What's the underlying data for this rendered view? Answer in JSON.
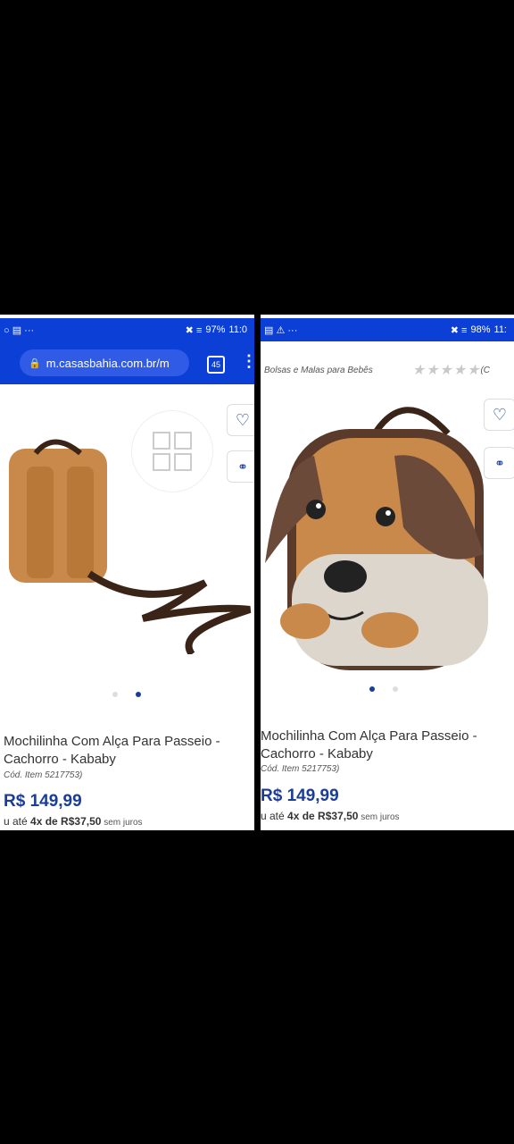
{
  "left": {
    "status": {
      "left_icons": "○ ▤ ···",
      "right_icons": "✖ ≡",
      "battery": "97%",
      "time": "11:0"
    },
    "url": "m.casasbahia.com.br/m",
    "tabs_count": "45",
    "product": {
      "title_line1": "Mochilinha Com Alça Para Passeio -",
      "title_line2": "Cachorro - Kababy",
      "code": "Cód. Item 5217753)",
      "price": "R$ 149,99",
      "installment_prefix": "u até ",
      "installment_bold": "4x de R$37,50",
      "installment_suffix": " sem juros"
    }
  },
  "right": {
    "status": {
      "left_icons": "▤ ⚠ ···",
      "right_icons": "✖ ≡",
      "battery": "98%",
      "time": "11:"
    },
    "breadcrumb": "Bolsas e Malas para Bebês",
    "rating_count": "(C",
    "product": {
      "title_line1": "Mochilinha Com Alça Para Passeio -",
      "title_line2": "Cachorro - Kababy",
      "code": "Cód. Item 5217753)",
      "price": "R$ 149,99",
      "installment_prefix": "u até ",
      "installment_bold": "4x de R$37,50",
      "installment_suffix": " sem juros"
    }
  },
  "icons": {
    "favorite": "heart-icon",
    "share": "share-icon",
    "lock": "lock-icon",
    "gallery": "grid-icon"
  },
  "colors": {
    "brand_blue": "#0b3fd6",
    "price_blue": "#1b3d9a",
    "backpack_tan": "#c8894a",
    "backpack_brown": "#5a3a2a"
  }
}
